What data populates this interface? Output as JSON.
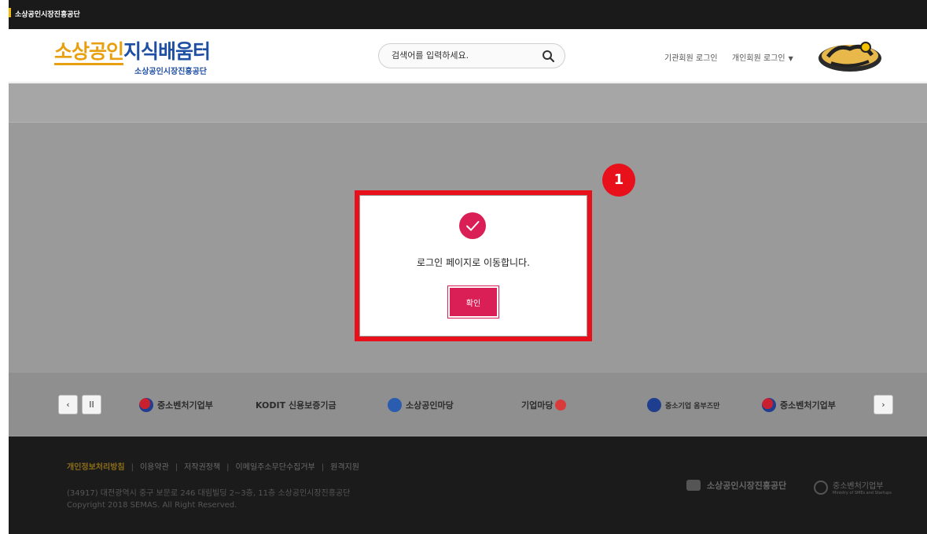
{
  "topbar": {
    "org_name": "소상공인시장진흥공단"
  },
  "header": {
    "logo_part1": "소상공인",
    "logo_part2": "지식배움터",
    "logo_sub": "소상공인시장진흥공단",
    "search_placeholder": "검색어를 입력하세요.",
    "inst_login": "기관회원 로그인",
    "personal_login": "개인회원 로그인",
    "caret": "▼"
  },
  "partners": {
    "prev": "‹",
    "pause": "II",
    "next": "›",
    "logos": [
      "중소벤처기업부",
      "KODIT 신용보증기금",
      "소상공인마당",
      "기업마당",
      "중소기업 옴부즈만",
      "중소벤처기업부"
    ]
  },
  "footer": {
    "links": [
      "개인정보처리방침",
      "이용약관",
      "저작권정책",
      "이메일주소무단수집거부",
      "원격지원"
    ],
    "address": "(34917) 대전광역시 중구 보문로 246 대림빌딩 2~3층, 11층 소상공인시장진흥공단",
    "copyright": "Copyright 2018 SEMAS. All Right Reserved.",
    "brand1": "소상공인시장진흥공단",
    "brand2": "중소벤처기업부",
    "brand2_sub": "Ministry of SMEs and Startups"
  },
  "modal": {
    "message": "로그인 페이지로 이동합니다.",
    "ok_label": "확인"
  },
  "annotation": {
    "step": "1"
  },
  "colors": {
    "accent": "#d91f55",
    "highlight": "#e8101a",
    "logo_orange": "#e8a010",
    "logo_blue": "#1e4fa3"
  }
}
